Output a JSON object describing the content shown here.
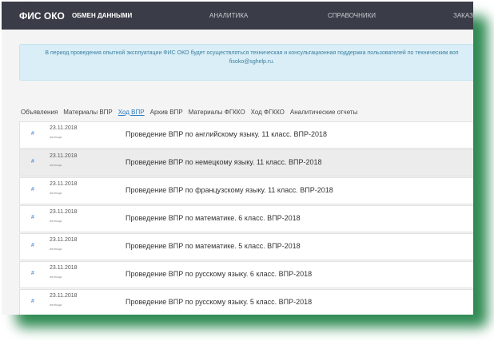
{
  "nav": {
    "logo": "ФИС ОКО",
    "items": [
      "ОБМЕН ДАННЫМИ",
      "АНАЛИТИКА",
      "СПРАВОЧНИКИ",
      "ЗАКАЗ"
    ]
  },
  "banner": {
    "text": "В период проведения опытной эксплуатации ФИС ОКО будет осуществляться техническая и консультационная поддержка пользователей по техническим воп",
    "email": "fisoko@sghelp.ru."
  },
  "tabs": [
    {
      "label": "Объявления"
    },
    {
      "label": "Материалы ВПР"
    },
    {
      "label": "Ход ВПР",
      "active": true
    },
    {
      "label": "Архив ВПР"
    },
    {
      "label": "Материалы ФГККО"
    },
    {
      "label": "Ход ФГККО"
    },
    {
      "label": "Аналитические отчеты"
    }
  ],
  "rows": [
    {
      "hash": "#",
      "date": "23.11.2018",
      "day": "пятница",
      "title": "Проведение ВПР по английскому языку. 11 класс. ВПР-2018"
    },
    {
      "hash": "#",
      "date": "23.11.2018",
      "day": "пятница",
      "title": "Проведение ВПР по немецкому языку. 11 класс. ВПР-2018",
      "highlighted": true
    },
    {
      "hash": "#",
      "date": "23.11.2018",
      "day": "пятница",
      "title": "Проведение ВПР по французскому языку. 11 класс. ВПР-2018"
    },
    {
      "hash": "#",
      "date": "23.11.2018",
      "day": "пятница",
      "title": "Проведение ВПР по математике. 6 класс. ВПР-2018"
    },
    {
      "hash": "#",
      "date": "23.11.2018",
      "day": "пятница",
      "title": "Проведение ВПР по математике. 5 класс. ВПР-2018"
    },
    {
      "hash": "#",
      "date": "23.11.2018",
      "day": "пятница",
      "title": "Проведение ВПР по русскому языку. 6 класс. ВПР-2018"
    },
    {
      "hash": "#",
      "date": "23.11.2018",
      "day": "пятница",
      "title": "Проведение ВПР по русскому языку. 5 класс. ВПР-2018"
    }
  ],
  "colors": {
    "nav_bg": "#3a3d47",
    "accent": "#2b7bc0",
    "frame_shadow": "#2e8a52"
  }
}
